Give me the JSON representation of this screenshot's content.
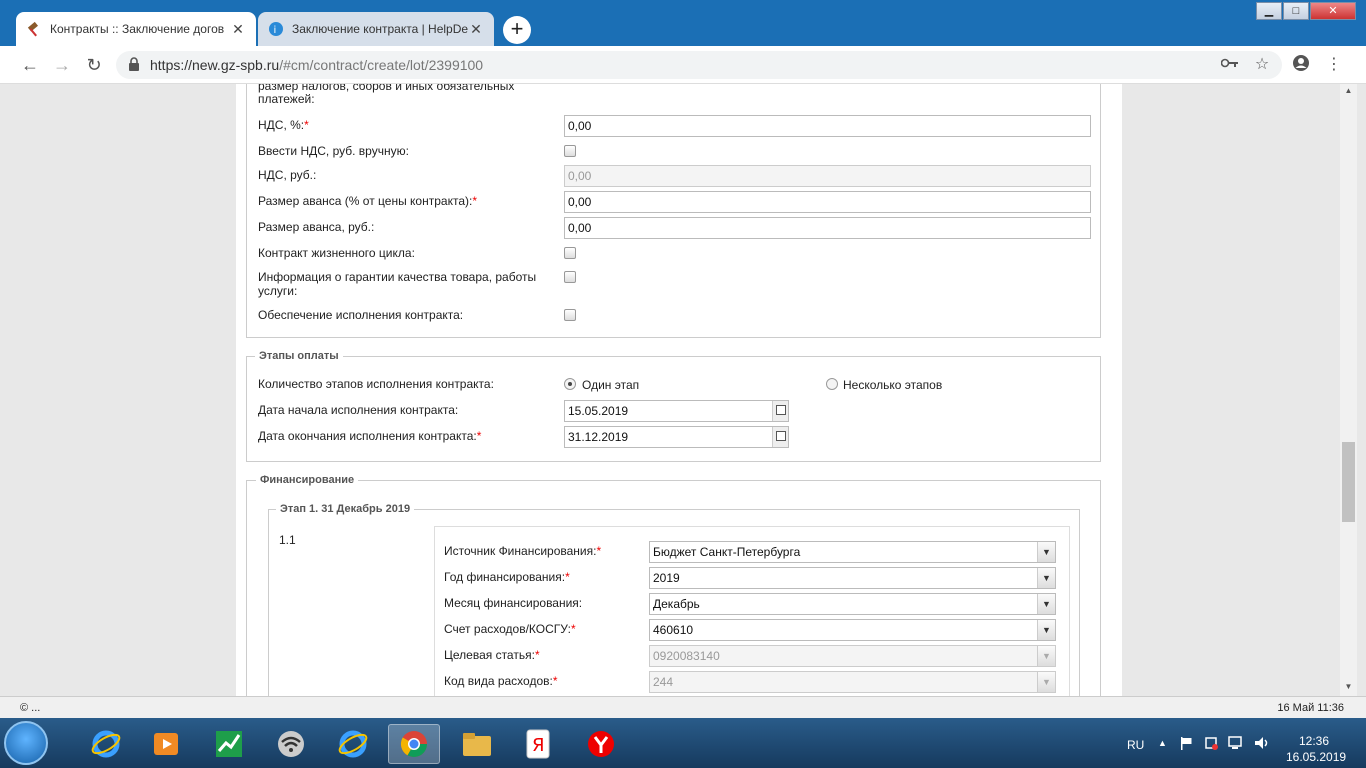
{
  "browser": {
    "tabs": [
      {
        "title": "Контракты :: Заключение догов",
        "icon": "gavel-icon",
        "active": true
      },
      {
        "title": "Заключение контракта | HelpDe",
        "icon": "help-icon",
        "active": false
      }
    ],
    "new_tab": "+",
    "url_host": "https://new.gz-spb.ru",
    "url_path": "/#cm/contract/create/lot/2399100",
    "window_controls": {
      "minimize": "▁",
      "maximize": "□",
      "close": "✕"
    }
  },
  "form": {
    "top_label_cut": "размер налогов, сборов и иных обязательных платежей:",
    "vat_pct_label": "НДС, %:",
    "vat_pct_value": "0,00",
    "vat_manual_label": "Ввести НДС, руб. вручную:",
    "vat_rub_label": "НДС, руб.:",
    "vat_rub_value": "0,00",
    "advance_pct_label": "Размер аванса (% от цены контракта):",
    "advance_pct_value": "0,00",
    "advance_rub_label": "Размер аванса, руб.:",
    "advance_rub_value": "0,00",
    "lifecycle_label": "Контракт жизненного цикла:",
    "quality_line1": "Информация о гарантии качества товара, работы",
    "quality_line2": "услуги:",
    "security_label": "Обеспечение исполнения контракта:",
    "required_mark": "*"
  },
  "payment_stages": {
    "legend": "Этапы оплаты",
    "count_label": "Количество этапов исполнения контракта:",
    "option_one": "Один этап",
    "option_many": "Несколько этапов",
    "start_label": "Дата начала исполнения контракта:",
    "start_value": "15.05.2019",
    "end_label": "Дата окончания исполнения контракта:",
    "end_value": "31.12.2019"
  },
  "financing": {
    "legend": "Финансирование",
    "stage_legend": "Этап 1. 31 Декабрь 2019",
    "row_num": "1.1",
    "source_label": "Источник Финансирования:",
    "source_value": "Бюджет Санкт-Петербурга",
    "year_label": "Год финансирования:",
    "year_value": "2019",
    "month_label": "Месяц финансирования:",
    "month_value": "Декабрь",
    "account_label": "Счет расходов/КОСГУ:",
    "account_value": "460610",
    "target_label": "Целевая статья:",
    "target_value": "0920083140",
    "kind_label": "Код вида расходов:",
    "kind_value": "244"
  },
  "statusbar": {
    "left": "© ...",
    "right": "16 Май 11:36"
  },
  "taskbar": {
    "lang": "RU",
    "time": "12:36",
    "date": "16.05.2019"
  }
}
